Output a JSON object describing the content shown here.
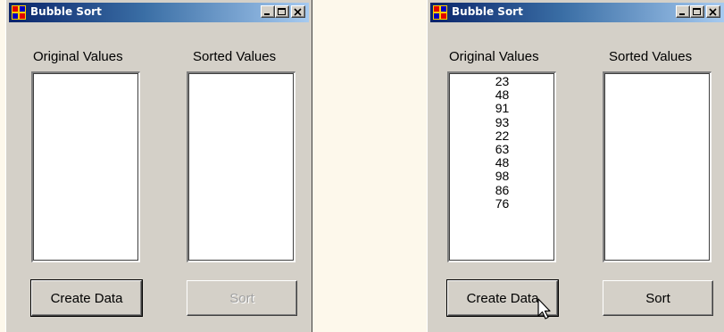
{
  "windows": [
    {
      "title": "Bubble Sort",
      "original_label": "Original Values",
      "sorted_label": "Sorted Values",
      "original_values": [],
      "sorted_values": [],
      "create_label": "Create Data",
      "sort_label": "Sort",
      "sort_enabled": false
    },
    {
      "title": "Bubble Sort",
      "original_label": "Original Values",
      "sorted_label": "Sorted Values",
      "original_values": [
        "23",
        "48",
        "91",
        "93",
        "22",
        "63",
        "48",
        "98",
        "86",
        "76"
      ],
      "sorted_values": [],
      "create_label": "Create Data",
      "sort_label": "Sort",
      "sort_enabled": true
    }
  ],
  "colors": {
    "titlebar_start": "#0a246a",
    "titlebar_end": "#a6caf0",
    "window_face": "#d4d0c8",
    "page_background": "#fdf8eb"
  },
  "icons": [
    "app-icon",
    "minimize-icon",
    "maximize-icon",
    "close-icon",
    "mouse-cursor-icon"
  ]
}
